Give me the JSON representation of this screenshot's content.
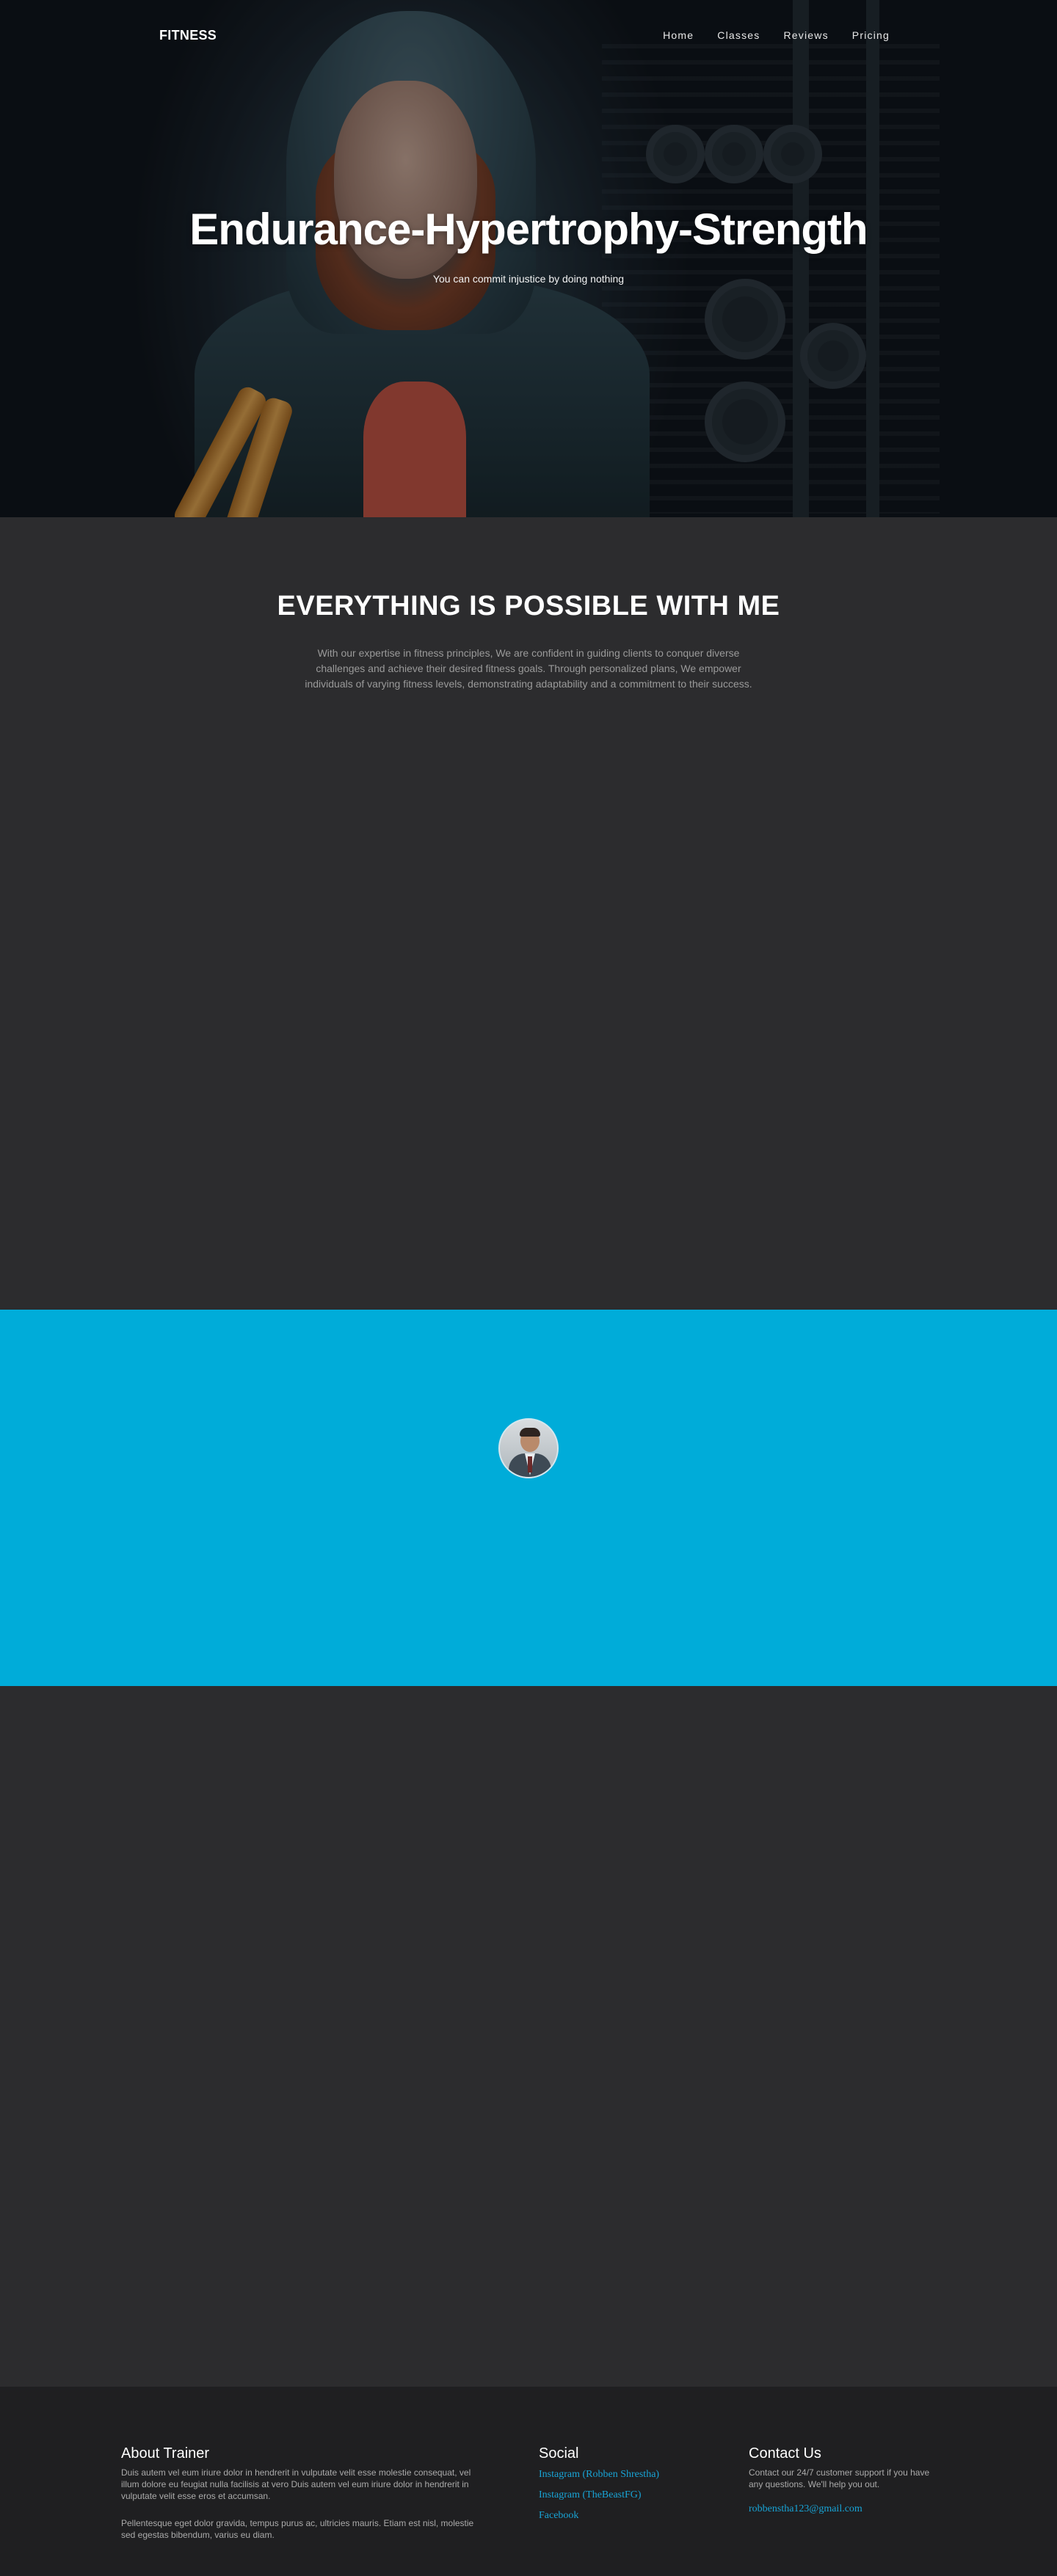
{
  "nav": {
    "brand": "FITNESS",
    "items": [
      {
        "label": "Home"
      },
      {
        "label": "Classes"
      },
      {
        "label": "Reviews"
      },
      {
        "label": "Pricing"
      }
    ]
  },
  "hero": {
    "title": "Endurance-Hypertrophy-Strength",
    "subtitle": "You can commit injustice by doing nothing"
  },
  "about": {
    "heading": "EVERYTHING IS POSSIBLE WITH ME",
    "text": "With our expertise in fitness principles, We are confident in guiding clients to conquer diverse challenges and achieve their desired fitness goals. Through personalized plans, We empower individuals of varying fitness levels, demonstrating adaptability and a commitment to their success."
  },
  "trainer": {
    "accent": "#00acd9"
  },
  "footer": {
    "about": {
      "heading": "About Trainer",
      "p1": "Duis autem vel eum iriure dolor in hendrerit in vulputate velit esse molestie consequat, vel illum dolore eu feugiat nulla facilisis at vero Duis autem vel eum iriure dolor in hendrerit in vulputate velit esse eros et accumsan.",
      "p2": "Pellentesque eget dolor gravida, tempus purus ac, ultricies mauris. Etiam est nisl, molestie sed egestas bibendum, varius eu diam."
    },
    "social": {
      "heading": "Social",
      "links": [
        {
          "label": "Instagram (Robben Shrestha)"
        },
        {
          "label": "Instagram (TheBeastFG)"
        },
        {
          "label": "Facebook"
        }
      ]
    },
    "contact": {
      "heading": "Contact Us",
      "text": "Contact our 24/7 customer support if you have any questions. We'll help you out.",
      "email": "robbenstha123@gmail.com"
    },
    "link_color": "#18a4d6"
  }
}
